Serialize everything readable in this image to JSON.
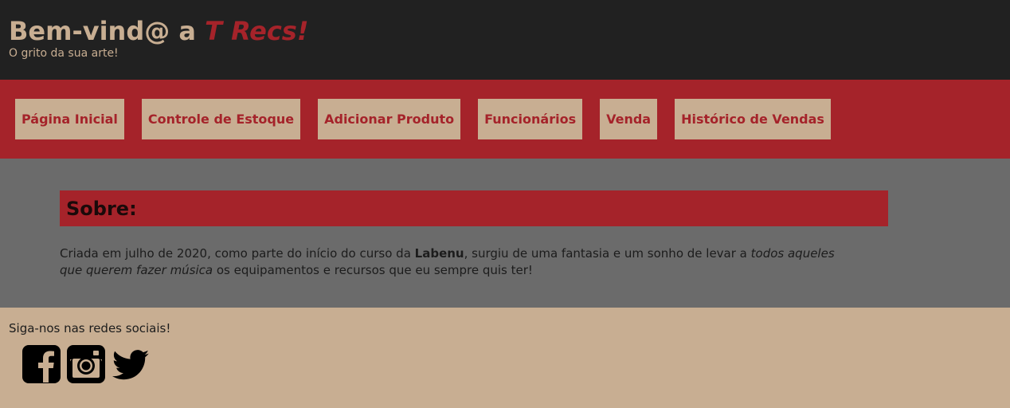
{
  "header": {
    "title_prefix": "Bem-vind@ a ",
    "title_brand": "T Recs!",
    "tagline": "O grito da sua arte!"
  },
  "nav": {
    "items": [
      {
        "label": "Página Inicial"
      },
      {
        "label": "Controle de Estoque"
      },
      {
        "label": "Adicionar Produto"
      },
      {
        "label": "Funcionários"
      },
      {
        "label": "Venda"
      },
      {
        "label": "Histórico de Vendas"
      }
    ]
  },
  "about": {
    "title": "Sobre:",
    "text_part1": "Criada em julho de 2020, como parte do início do curso da ",
    "text_bold": "Labenu",
    "text_part2": ", surgiu de uma fantasia e um sonho de levar a ",
    "text_italic": "todos aqueles que querem fazer música",
    "text_part3": " os equipamentos e recursos que eu sempre quis ter!"
  },
  "footer": {
    "follow_text": "Siga-nos nas redes sociais!",
    "socials": [
      {
        "icon": "facebook-icon"
      },
      {
        "icon": "instagram-icon"
      },
      {
        "icon": "twitter-icon"
      }
    ]
  },
  "colors": {
    "dark": "#212121",
    "accent_red": "#a5232a",
    "tan": "#c8ae92",
    "gray": "#6b6b6b"
  }
}
